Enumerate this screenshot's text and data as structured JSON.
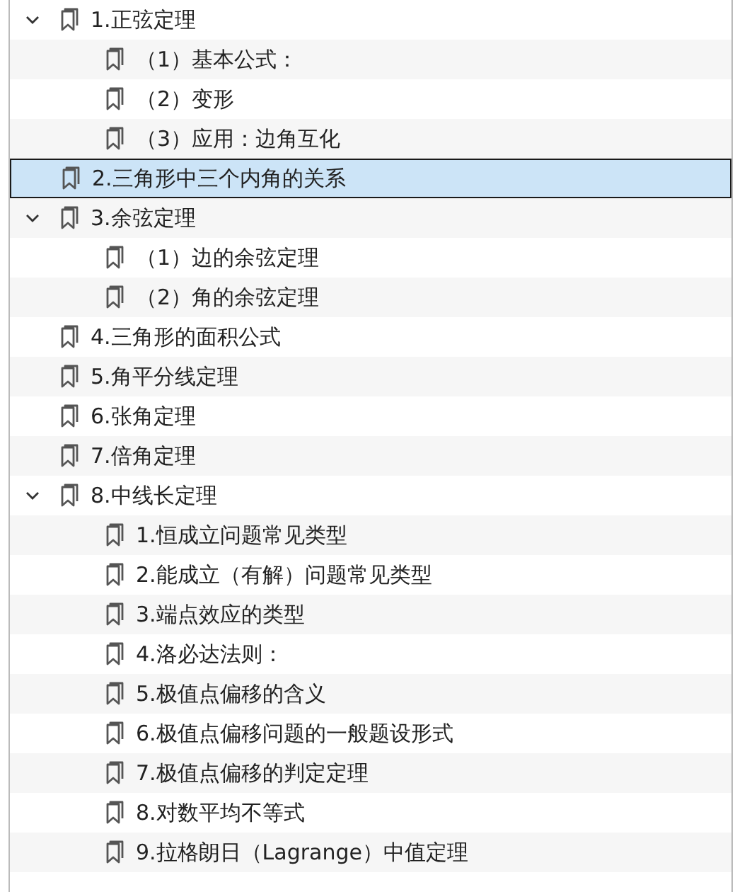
{
  "bookmarks": [
    {
      "label": "1.正弦定理",
      "expanded": true,
      "selected": false,
      "children": [
        {
          "label": "（1）基本公式：",
          "selected": false
        },
        {
          "label": "（2）变形",
          "selected": false
        },
        {
          "label": "（3）应用：边角互化",
          "selected": false
        }
      ]
    },
    {
      "label": "2.三角形中三个内角的关系",
      "selected": true
    },
    {
      "label": "3.余弦定理",
      "expanded": true,
      "selected": false,
      "children": [
        {
          "label": "（1）边的余弦定理",
          "selected": false
        },
        {
          "label": "（2）角的余弦定理",
          "selected": false
        }
      ]
    },
    {
      "label": "4.三角形的面积公式",
      "selected": false
    },
    {
      "label": "5.角平分线定理",
      "selected": false
    },
    {
      "label": "6.张角定理",
      "selected": false
    },
    {
      "label": "7.倍角定理",
      "selected": false
    },
    {
      "label": "8.中线长定理",
      "expanded": true,
      "selected": false,
      "children": [
        {
          "label": "1.恒成立问题常见类型",
          "selected": false
        },
        {
          "label": "2.能成立（有解）问题常见类型",
          "selected": false
        },
        {
          "label": "3.端点效应的类型",
          "selected": false
        },
        {
          "label": "4.洛必达法则：",
          "selected": false
        },
        {
          "label": "5.极值点偏移的含义",
          "selected": false
        },
        {
          "label": "6.极值点偏移问题的一般题设形式",
          "selected": false
        },
        {
          "label": "7.极值点偏移的判定定理",
          "selected": false
        },
        {
          "label": "8.对数平均不等式",
          "selected": false
        },
        {
          "label": "9.拉格朗日（Lagrange）中值定理",
          "selected": false
        }
      ]
    }
  ]
}
